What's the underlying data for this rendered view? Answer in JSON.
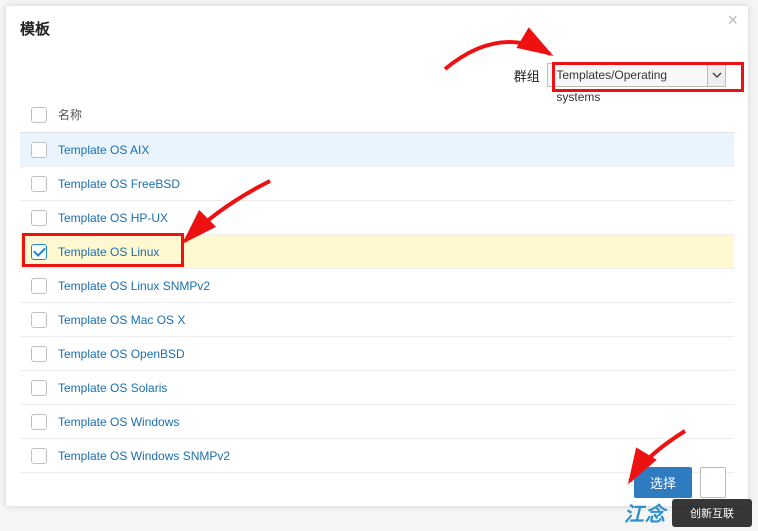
{
  "modal": {
    "title": "模板",
    "group_label": "群组",
    "group_value": "Templates/Operating systems",
    "column_name": "名称",
    "rows": [
      {
        "label": "Template OS AIX",
        "checked": false,
        "highlight": "blue"
      },
      {
        "label": "Template OS FreeBSD",
        "checked": false,
        "highlight": ""
      },
      {
        "label": "Template OS HP-UX",
        "checked": false,
        "highlight": ""
      },
      {
        "label": "Template OS Linux",
        "checked": true,
        "highlight": "yellow"
      },
      {
        "label": "Template OS Linux SNMPv2",
        "checked": false,
        "highlight": ""
      },
      {
        "label": "Template OS Mac OS X",
        "checked": false,
        "highlight": ""
      },
      {
        "label": "Template OS OpenBSD",
        "checked": false,
        "highlight": ""
      },
      {
        "label": "Template OS Solaris",
        "checked": false,
        "highlight": ""
      },
      {
        "label": "Template OS Windows",
        "checked": false,
        "highlight": ""
      },
      {
        "label": "Template OS Windows SNMPv2",
        "checked": false,
        "highlight": ""
      }
    ],
    "primary_btn": "选择",
    "secondary_btn": ""
  },
  "watermark": {
    "text": "江念",
    "logo": "创新互联"
  }
}
